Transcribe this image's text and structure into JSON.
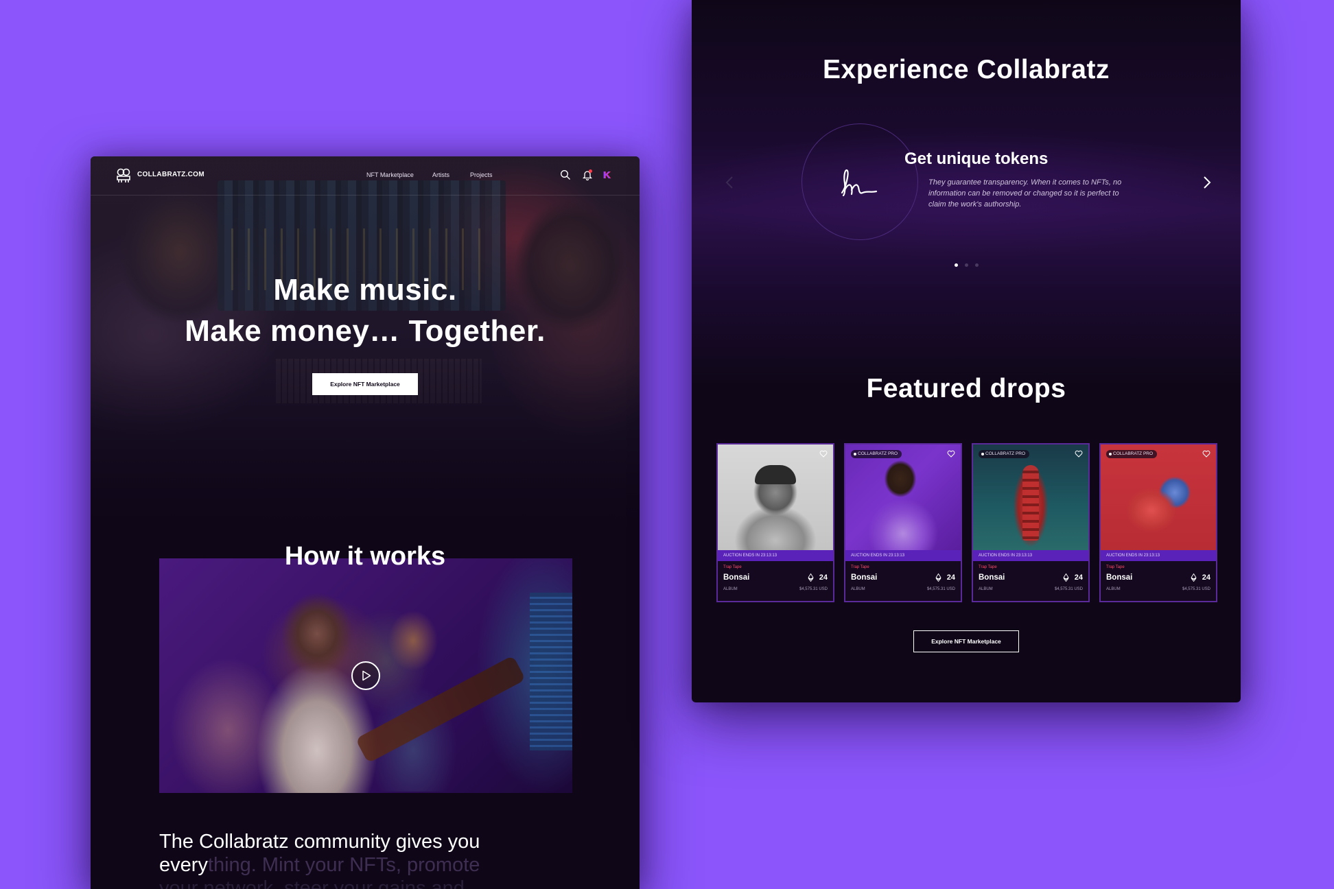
{
  "colors": {
    "background": "#8b55fb",
    "panel": "#0f0718",
    "accent": "#5a22b8",
    "card_border": "#5a2a9a",
    "notification": "#ff3b4a",
    "trending": "#ff4a6a"
  },
  "left_page": {
    "logo_text": "COLLABRATZ.COM",
    "nav": [
      "NFT Marketplace",
      "Artists",
      "Projects"
    ],
    "icons": [
      "search-icon",
      "bell-icon",
      "user-avatar"
    ],
    "hero_line1": "Make music.",
    "hero_line2": "Make money… Together.",
    "hero_button": "Explore NFT Marketplace",
    "how_title": "How it works",
    "community_bright": "The Collabratz community gives you every",
    "community_dim1": "thing. Mint your NFTs, promote",
    "community_dim2": "your network, steer your gains and"
  },
  "right_page": {
    "experience_title": "Experience Collabratz",
    "token_title": "Get unique tokens",
    "token_desc": "They guarantee transparency. When it comes to NFTs, no information can be removed or changed so it is perfect to claim the work's authorship.",
    "carousel_pages": 3,
    "carousel_active": 0,
    "featured_title": "Featured drops",
    "cards": [
      {
        "pro": "",
        "auction": "AUCTION ENDS IN 23:13:13",
        "trending": "Trap Tape",
        "name": "Bonsai",
        "price": "24",
        "meta": "ALBUM",
        "usd": "$4,575.31 USD",
        "art": "photo-bw"
      },
      {
        "pro": "COLLABRATZ PRO",
        "auction": "AUCTION ENDS IN 23:13:13",
        "trending": "Trap Tape",
        "name": "Bonsai",
        "price": "24",
        "meta": "ALBUM",
        "usd": "$4,575.31 USD",
        "art": "photo-purple"
      },
      {
        "pro": "COLLABRATZ PRO",
        "auction": "AUCTION ENDS IN 23:13:13",
        "trending": "Trap Tape",
        "name": "Bonsai",
        "price": "24",
        "meta": "ALBUM",
        "usd": "$4,575.31 USD",
        "art": "mask-teal"
      },
      {
        "pro": "COLLABRATZ PRO",
        "auction": "AUCTION ENDS IN 23:13:13",
        "trending": "Trap Tape",
        "name": "Bonsai",
        "price": "24",
        "meta": "ALBUM",
        "usd": "$4,575.31 USD",
        "art": "ball-red"
      }
    ],
    "explore_button": "Explore NFT Marketplace"
  }
}
